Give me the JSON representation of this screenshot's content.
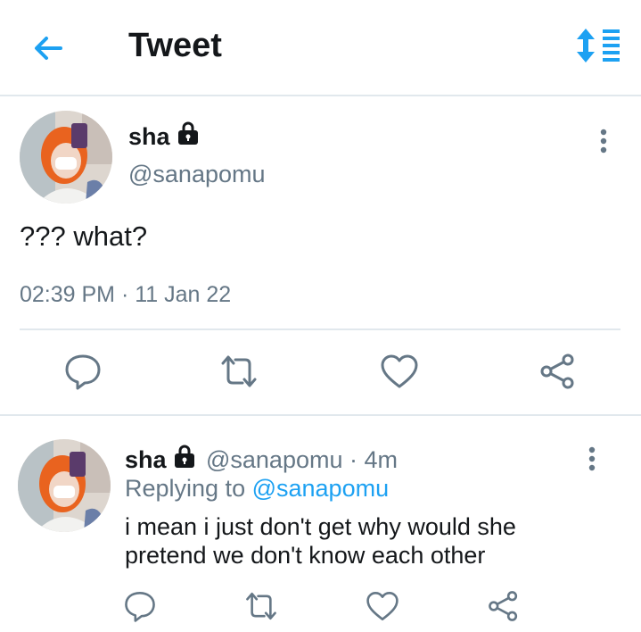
{
  "header": {
    "title": "Tweet"
  },
  "main_tweet": {
    "name": "sha",
    "handle": "@sanapomu",
    "text": "??? what?",
    "timestamp": "02:39 PM · 11 Jan 22"
  },
  "reply_tweet": {
    "name": "sha",
    "handle": "@sanapomu",
    "separator": " · ",
    "age": "4m",
    "replying_prefix": "Replying to ",
    "replying_to": "@sanapomu",
    "text_line1": "i mean i just don't get why would she",
    "text_line2": "pretend we don't know each other"
  },
  "colors": {
    "accent": "#1da1f2",
    "secondary_text": "#657786",
    "icon": "#657786",
    "divider": "#e1e8ed"
  },
  "icons": [
    "back-arrow-icon",
    "sort-icon",
    "lock-icon",
    "more-icon",
    "reply-icon",
    "retweet-icon",
    "like-icon",
    "share-icon"
  ]
}
